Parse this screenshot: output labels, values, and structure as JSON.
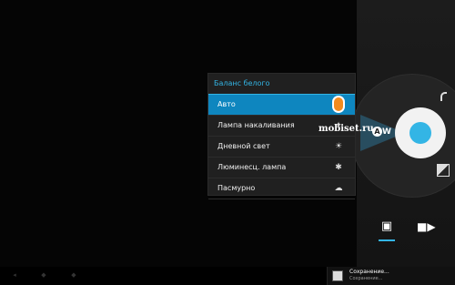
{
  "white_balance_menu": {
    "title": "Баланс белого",
    "items": [
      {
        "label": "Авто",
        "icon": "auto-marker-icon",
        "selected": true
      },
      {
        "label": "Лампа накаливания",
        "icon": "incandescent-icon",
        "selected": false
      },
      {
        "label": "Дневной свет",
        "icon": "sun-icon",
        "selected": false
      },
      {
        "label": "Люминесц. лампа",
        "icon": "fluorescent-icon",
        "selected": false
      },
      {
        "label": "Пасмурно",
        "icon": "cloud-icon",
        "selected": false
      }
    ]
  },
  "controls": {
    "awb_label": "A",
    "awb_suffix": "W"
  },
  "watermark": "mobiset.ru",
  "mode_switch": {
    "active": "camera",
    "camera_icon": "camera-icon",
    "video_icon": "video-camera-icon"
  },
  "notification": {
    "title": "Сохранение...",
    "subtitle": "Сохранение..."
  },
  "colors": {
    "accent": "#33b5e5",
    "selected_item": "#0e86bf",
    "marker": "#f28b1e"
  }
}
